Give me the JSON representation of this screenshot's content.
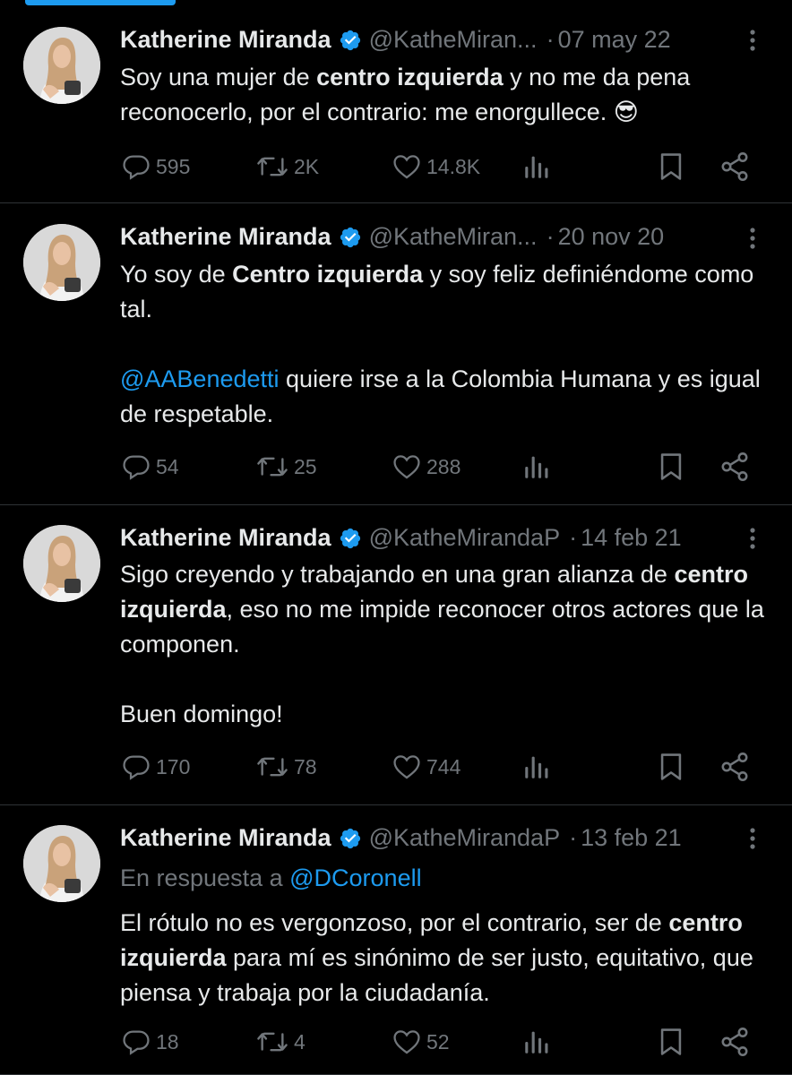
{
  "tweets": [
    {
      "name": "Katherine Miranda",
      "handle": "@KatheMiran...",
      "separator": "·",
      "date": "07 may 22",
      "reply_to_prefix": "",
      "reply_to_handle": "",
      "paragraphs": [
        [
          {
            "text": "Soy una mujer de ",
            "bold": false
          },
          {
            "text": "centro izquierda",
            "bold": true
          },
          {
            "text": " y no me da pena reconocerlo, por el contrario: me enorgullece. 😎",
            "bold": false
          }
        ]
      ],
      "replies": "595",
      "reposts": "2K",
      "likes": "14.8K"
    },
    {
      "name": "Katherine Miranda",
      "handle": "@KatheMiran...",
      "separator": "·",
      "date": "20 nov 20",
      "reply_to_prefix": "",
      "reply_to_handle": "",
      "paragraphs": [
        [
          {
            "text": "Yo soy de ",
            "bold": false
          },
          {
            "text": "Centro izquierda",
            "bold": true
          },
          {
            "text": " y soy feliz definiéndome como tal.",
            "bold": false
          }
        ],
        [
          {
            "text": "@AABenedetti",
            "mention": true
          },
          {
            "text": " quiere irse a la Colombia Humana y es igual de respetable.",
            "bold": false
          }
        ]
      ],
      "replies": "54",
      "reposts": "25",
      "likes": "288"
    },
    {
      "name": "Katherine Miranda",
      "handle": "@KatheMirandaP",
      "separator": "·",
      "date": "14 feb 21",
      "reply_to_prefix": "",
      "reply_to_handle": "",
      "paragraphs": [
        [
          {
            "text": "Sigo creyendo y trabajando en una gran alianza de ",
            "bold": false
          },
          {
            "text": "centro izquierda",
            "bold": true
          },
          {
            "text": ", eso no me impide reconocer otros actores que la componen.",
            "bold": false
          }
        ],
        [
          {
            "text": "Buen domingo!",
            "bold": false
          }
        ]
      ],
      "replies": "170",
      "reposts": "78",
      "likes": "744"
    },
    {
      "name": "Katherine Miranda",
      "handle": "@KatheMirandaP",
      "separator": "·",
      "date": "13 feb 21",
      "reply_to_prefix": "En respuesta a ",
      "reply_to_handle": "@DCoronell",
      "paragraphs": [
        [
          {
            "text": "El rótulo no es vergonzoso, por el contrario, ser de ",
            "bold": false
          },
          {
            "text": "centro izquierda",
            "bold": true
          },
          {
            "text": " para mí es sinónimo de ser justo, equitativo, que piensa y trabaja por la ciudadanía.",
            "bold": false
          }
        ]
      ],
      "replies": "18",
      "reposts": "4",
      "likes": "52"
    }
  ],
  "colors": {
    "background": "#000000",
    "text": "#e7e9ea",
    "secondary": "#71767b",
    "accent": "#1d9bf0",
    "divider": "#2f3336"
  },
  "icons": [
    "verified-badge-icon",
    "more-options-icon",
    "reply-icon",
    "repost-icon",
    "like-icon",
    "views-icon",
    "bookmark-icon",
    "share-icon"
  ]
}
